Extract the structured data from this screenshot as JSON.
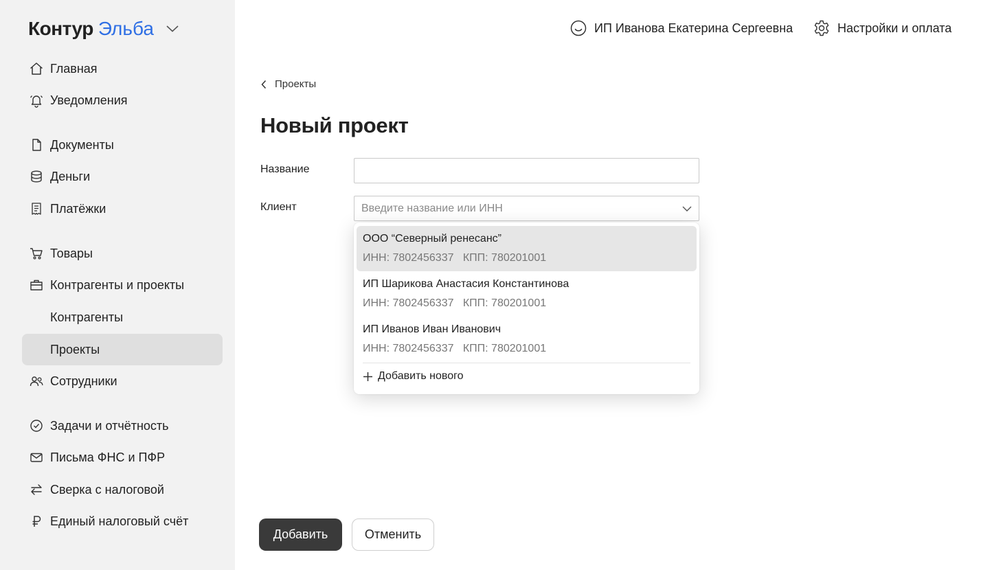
{
  "brand": {
    "name": "Контур",
    "product": "Эльба"
  },
  "sidebar": {
    "items": [
      {
        "label": "Главная",
        "icon": "home-icon"
      },
      {
        "label": "Уведомления",
        "icon": "bell-icon"
      },
      {
        "label": "Документы",
        "icon": "document-icon"
      },
      {
        "label": "Деньги",
        "icon": "coins-icon"
      },
      {
        "label": "Платёжки",
        "icon": "receipt-icon"
      },
      {
        "label": "Товары",
        "icon": "cart-icon"
      },
      {
        "label": "Контрагенты и проекты",
        "icon": "briefcase-icon"
      },
      {
        "label": "Контрагенты"
      },
      {
        "label": "Проекты",
        "active": true
      },
      {
        "label": "Сотрудники",
        "icon": "people-icon"
      },
      {
        "label": "Задачи и отчётность",
        "icon": "check-circle-icon"
      },
      {
        "label": "Письма ФНС и ПФР",
        "icon": "mail-icon"
      },
      {
        "label": "Сверка с налоговой",
        "icon": "swap-arrows-icon"
      },
      {
        "label": "Единый налоговый счёт",
        "icon": "ruble-icon"
      }
    ]
  },
  "header": {
    "user_name": "ИП Иванова Екатерина Сергеевна",
    "settings_label": "Настройки и оплата"
  },
  "breadcrumb": {
    "label": "Проекты"
  },
  "page_title": "Новый проект",
  "form": {
    "name_label": "Название",
    "name_value": "",
    "client_label": "Клиент",
    "client_placeholder": "Введите название или ИНН"
  },
  "dropdown": {
    "options": [
      {
        "name": "ООО “Северный ренесанс”",
        "inn": "ИНН: 7802456337",
        "kpp": "КПП: 780201001",
        "highlighted": true
      },
      {
        "name": "ИП Шарикова Анастасия Константинова",
        "inn": "ИНН: 7802456337",
        "kpp": "КПП: 780201001"
      },
      {
        "name": "ИП Иванов Иван Иванович",
        "inn": "ИНН: 7802456337",
        "kpp": "КПП: 780201001"
      }
    ],
    "add_new_label": "Добавить нового"
  },
  "actions": {
    "submit_label": "Добавить",
    "cancel_label": "Отменить"
  },
  "colors": {
    "accent": "#2f6fe4",
    "sidebar_bg": "#f2f2f2",
    "active_item_bg": "#dfdfdf",
    "primary_button": "#3a3a3a"
  }
}
